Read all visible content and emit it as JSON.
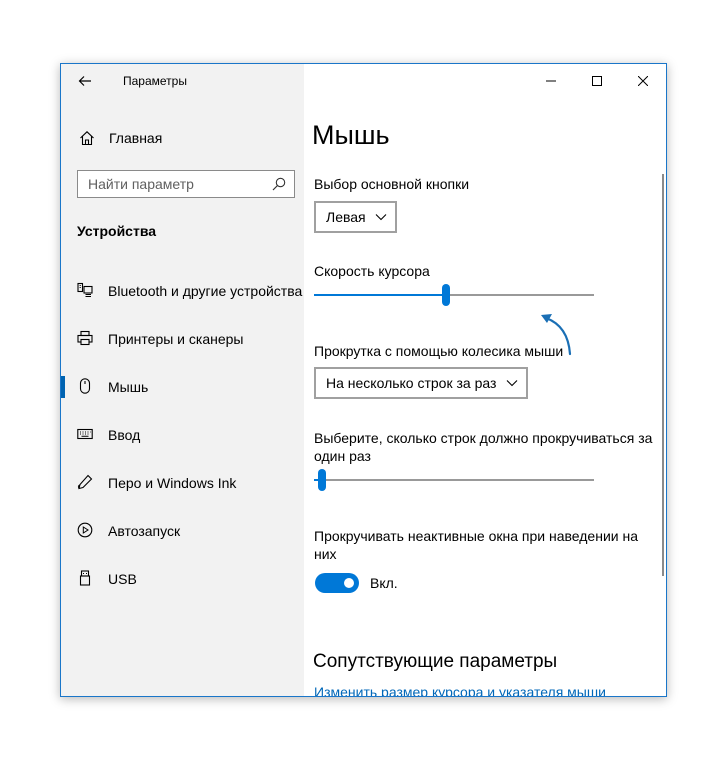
{
  "window": {
    "app_title": "Параметры"
  },
  "sidebar": {
    "home_label": "Главная",
    "search_placeholder": "Найти параметр",
    "section_header": "Устройства",
    "items": [
      {
        "label": "Bluetooth и другие устройства",
        "icon": "bluetooth-devices-icon"
      },
      {
        "label": "Принтеры и сканеры",
        "icon": "printer-icon"
      },
      {
        "label": "Мышь",
        "icon": "mouse-icon",
        "selected": true
      },
      {
        "label": "Ввод",
        "icon": "keyboard-icon"
      },
      {
        "label": "Перо и Windows Ink",
        "icon": "pen-icon"
      },
      {
        "label": "Автозапуск",
        "icon": "autoplay-icon"
      },
      {
        "label": "USB",
        "icon": "usb-icon"
      }
    ]
  },
  "content": {
    "page_title": "Мышь",
    "primary_button": {
      "label": "Выбор основной кнопки",
      "value": "Левая"
    },
    "cursor_speed": {
      "label": "Скорость курсора",
      "value_fraction": 0.47
    },
    "wheel_scroll": {
      "label": "Прокрутка с помощью колесика мыши",
      "value": "На несколько строк за раз"
    },
    "lines_to_scroll": {
      "label_line1": "Выберите, сколько строк должно прокручиваться за",
      "label_line2": "один раз",
      "value_fraction": 0.03
    },
    "inactive_scroll": {
      "label_line1": "Прокручивать неактивные окна при наведении на",
      "label_line2": "них",
      "toggle_state": "Вкл.",
      "on": true
    },
    "related": {
      "title": "Сопутствующие параметры",
      "link": "Изменить размер курсора и указателя мыши"
    }
  },
  "colors": {
    "accent": "#0078d7",
    "link": "#0067b8",
    "sidebar_bg": "#f2f2f2",
    "window_border": "#1a76c9"
  }
}
